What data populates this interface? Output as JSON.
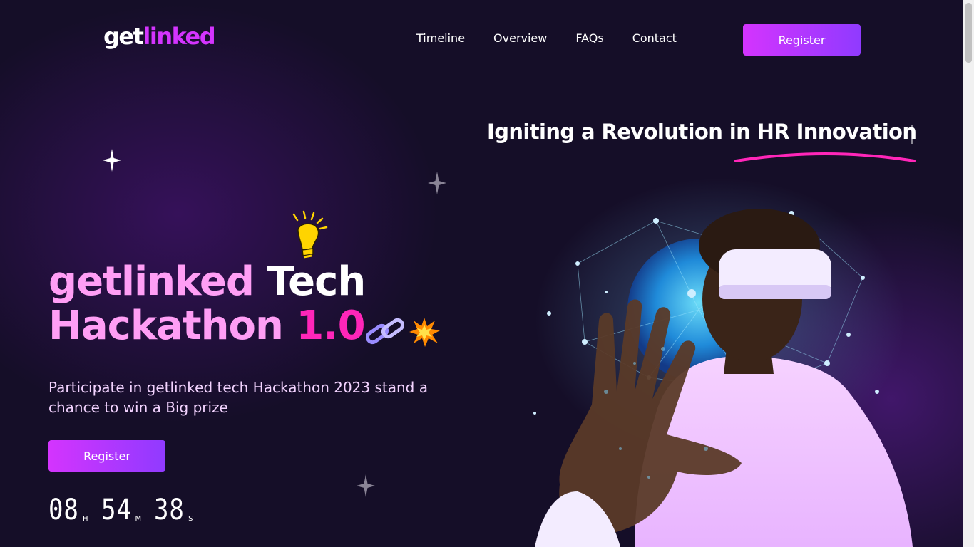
{
  "brand": {
    "logo_part1": "get",
    "logo_part2": "linked"
  },
  "nav": {
    "items": [
      "Timeline",
      "Overview",
      "FAQs",
      "Contact"
    ]
  },
  "header": {
    "register_label": "Register"
  },
  "hero": {
    "tagline": "Igniting a Revolution in HR Innovation",
    "title_line1_a": "getlinked",
    "title_line1_b": " Tech",
    "title_line2_a": "Hackathon ",
    "title_line2_b": "1.0",
    "subtitle": "Participate in getlinked tech Hackathon 2023 stand a chance to win a Big prize",
    "register_label": "Register"
  },
  "countdown": {
    "hours": "08",
    "hours_unit": "H",
    "minutes": "54",
    "minutes_unit": "M",
    "seconds": "38",
    "seconds_unit": "S"
  },
  "icons": [
    "sparkle-star-icon",
    "lightbulb-icon",
    "chain-link-icon",
    "explosion-icon"
  ],
  "colors": {
    "accent": "#d434fe",
    "accent2": "#903aff",
    "hot_pink": "#ff26b9",
    "background": "#150e28"
  }
}
